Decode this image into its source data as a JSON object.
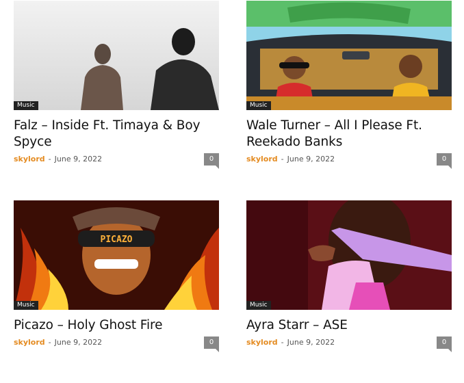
{
  "posts": [
    {
      "category": "Music",
      "title": "Falz – Inside Ft. Timaya & Boy Spyce",
      "author": "skylord",
      "separator": "-",
      "date": "June 9, 2022",
      "comments": "0"
    },
    {
      "category": "Music",
      "title": "Wale Turner – All I Please Ft. Reekado Banks",
      "author": "skylord",
      "separator": "-",
      "date": "June 9, 2022",
      "comments": "0"
    },
    {
      "category": "Music",
      "title": "Picazo – Holy Ghost Fire",
      "author": "skylord",
      "separator": "-",
      "date": "June 9, 2022",
      "comments": "0"
    },
    {
      "category": "Music",
      "title": "Ayra Starr – ASE",
      "author": "skylord",
      "separator": "-",
      "date": "June 9, 2022",
      "comments": "0"
    }
  ],
  "thumb_lettering": {
    "picazo_visor": "PICAZO"
  },
  "colors": {
    "author": "#e48b21",
    "category_bg": "#222222",
    "comment_bubble": "#888888",
    "title": "#111111"
  }
}
